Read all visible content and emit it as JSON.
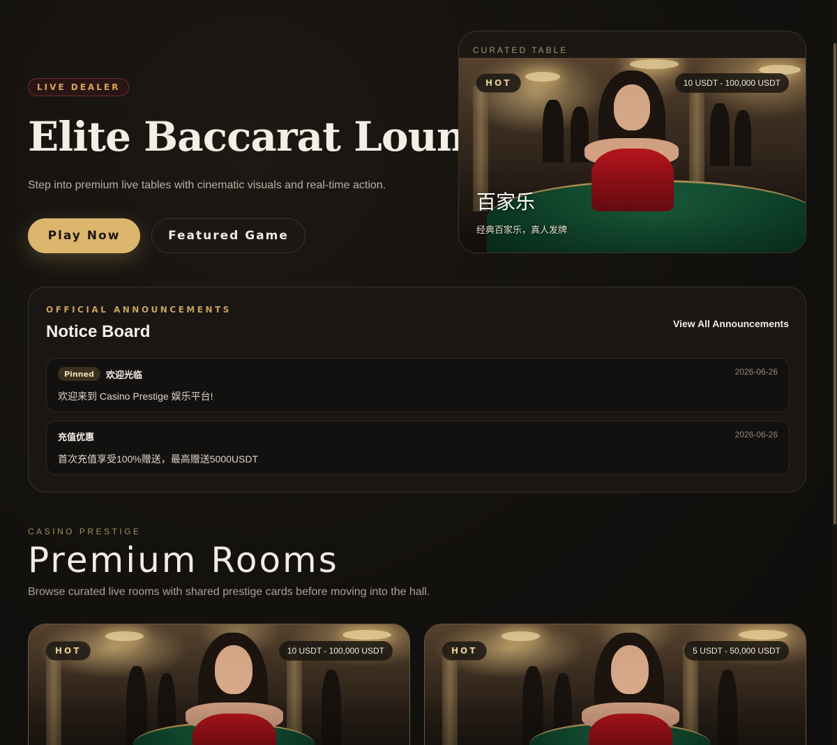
{
  "hero": {
    "badge": "LIVE DEALER",
    "title": "Elite Baccarat Lounge",
    "subtitle": "Step into premium live tables with cinematic visuals and real-time action.",
    "play_label": "Play Now",
    "featured_label": "Featured Game"
  },
  "curated": {
    "kicker": "CURATED TABLE",
    "hot": "HOT",
    "range": "10 USDT - 100,000 USDT",
    "name": "百家乐",
    "description": "经典百家乐，真人发牌"
  },
  "notice": {
    "kicker": "OFFICIAL ANNOUNCEMENTS",
    "title": "Notice Board",
    "view_all": "View All Announcements",
    "items": [
      {
        "pinned": "Pinned",
        "title": "欢迎光临",
        "body": "欢迎来到 Casino Prestige 娱乐平台!",
        "date": "2026-06-26"
      },
      {
        "title": "充值优惠",
        "body": "首次充值享受100%赠送，最高赠送5000USDT",
        "date": "2026-06-26"
      }
    ]
  },
  "rooms": {
    "kicker": "CASINO PRESTIGE",
    "title": "Premium Rooms",
    "subtitle": "Browse curated live rooms with shared prestige cards before moving into the hall.",
    "cards": [
      {
        "hot": "HOT",
        "range": "10 USDT - 100,000 USDT"
      },
      {
        "hot": "HOT",
        "range": "5 USDT - 50,000 USDT"
      }
    ]
  },
  "colors": {
    "accent_gold": "#ddb66e",
    "background": "#13110e",
    "dress_red": "#b3141c",
    "table_green": "#1f6b45"
  }
}
